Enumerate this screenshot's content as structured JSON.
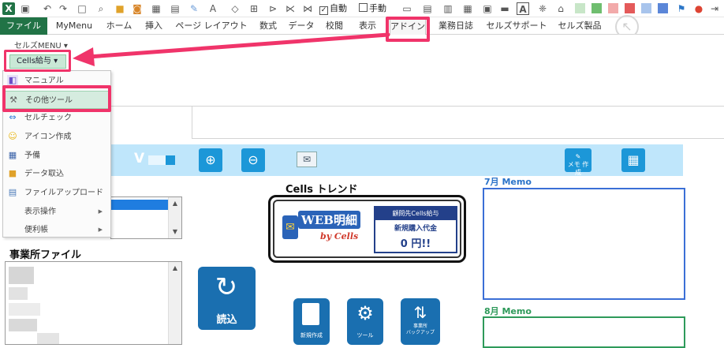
{
  "qat": {
    "excel_logo": "X",
    "auto_label": "自動",
    "manual_label": "手動",
    "font_letter": "A",
    "alpha_letter": "A"
  },
  "tabs": [
    "ファイル",
    "MyMenu",
    "ホーム",
    "挿入",
    "ページ レイアウト",
    "数式",
    "データ",
    "校閲",
    "表示",
    "アドイン",
    "業務日誌",
    "セルズサポート",
    "セルズ製品"
  ],
  "ribbon": {
    "group_label": "セルズMENU",
    "dropdown_label": "Cells給与"
  },
  "menu": {
    "items": [
      {
        "label": "マニュアル",
        "icon": "manual-icon",
        "submenu": false
      },
      {
        "label": "その他ツール",
        "icon": "tools-icon",
        "submenu": false
      },
      {
        "label": "セルチェック",
        "icon": "link-icon",
        "submenu": false
      },
      {
        "label": "アイコン作成",
        "icon": "smiley-icon",
        "submenu": false
      },
      {
        "label": "予備",
        "icon": "calendar-icon",
        "submenu": false
      },
      {
        "label": "データ取込",
        "icon": "folder-icon",
        "submenu": false
      },
      {
        "label": "ファイルアップロード",
        "icon": "upload-icon",
        "submenu": false
      },
      {
        "label": "表示操作",
        "icon": "",
        "submenu": true
      },
      {
        "label": "便利帳",
        "icon": "",
        "submenu": true
      }
    ]
  },
  "sheet": {
    "version_text": "V",
    "trend_title": "Cells トレンド",
    "web_meisai_title": "WEB明細",
    "web_meisai_sub": "by Cells",
    "promo_line1": "顧問先Cells給与",
    "promo_line2": "新規購入代金",
    "promo_line3": "0 円!!",
    "office_files_title": "事業所ファイル",
    "memo_july": "7月 Memo",
    "memo_august": "8月 Memo",
    "memo_button_label": "メモ\n作成",
    "load_button_label": "読込",
    "new_button_label": "新規作成",
    "tool_button_label": "ツール",
    "backup_button_label": "事業所\nバックアップ"
  },
  "colors": {
    "highlight": "#f0346a",
    "excel_green": "#217346",
    "banner_bg": "#bfe6fb",
    "button_blue": "#1c97d8",
    "memo_july_border": "#3b6fd6",
    "memo_august_border": "#2e9a5a"
  }
}
